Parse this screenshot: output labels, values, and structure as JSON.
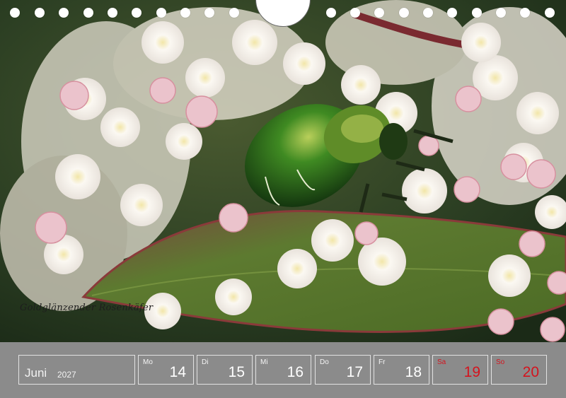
{
  "photo": {
    "caption": "Goldglänzender Rosenkäfer",
    "colors": {
      "background": "#24361f",
      "leaf": "#5f7a2e",
      "leaf_edge": "#8a3a3a",
      "blossom": "#f6f3ee",
      "bud": "#e8b9c6",
      "beetle": "#2e6b1e"
    }
  },
  "binding": {
    "hole_count": 22,
    "hanger_icon": "hanger-cutout-icon"
  },
  "calendar": {
    "month": "Juni",
    "year": "2027",
    "days": [
      {
        "name": "Mo",
        "num": "14",
        "weekend": false
      },
      {
        "name": "Di",
        "num": "15",
        "weekend": false
      },
      {
        "name": "Mi",
        "num": "16",
        "weekend": false
      },
      {
        "name": "Do",
        "num": "17",
        "weekend": false
      },
      {
        "name": "Fr",
        "num": "18",
        "weekend": false
      },
      {
        "name": "Sa",
        "num": "19",
        "weekend": true
      },
      {
        "name": "So",
        "num": "20",
        "weekend": true
      }
    ],
    "weekend_color": "#d4141e"
  }
}
